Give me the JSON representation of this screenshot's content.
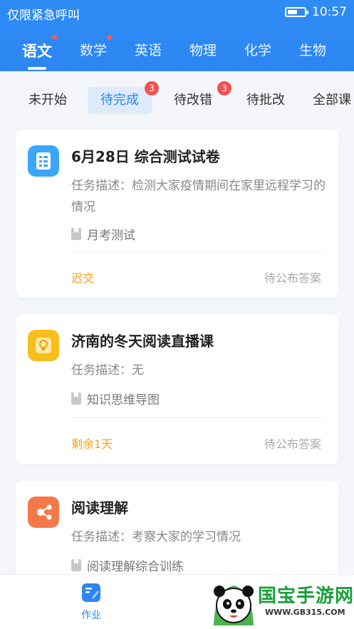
{
  "status_bar": {
    "carrier": "仅限紧急呼叫",
    "time": "10:57",
    "battery_level": 0.6
  },
  "subjects": [
    {
      "label": "语文",
      "active": true,
      "dot": true
    },
    {
      "label": "数学",
      "active": false,
      "dot": true
    },
    {
      "label": "英语",
      "active": false,
      "dot": false
    },
    {
      "label": "物理",
      "active": false,
      "dot": false
    },
    {
      "label": "化学",
      "active": false,
      "dot": false
    },
    {
      "label": "生物",
      "active": false,
      "dot": false
    }
  ],
  "status_tabs": [
    {
      "label": "未开始",
      "active": false,
      "badge": ""
    },
    {
      "label": "待完成",
      "active": true,
      "badge": "3"
    },
    {
      "label": "待改错",
      "active": false,
      "badge": "3"
    },
    {
      "label": "待批改",
      "active": false,
      "badge": ""
    },
    {
      "label": "全部课",
      "active": false,
      "badge": ""
    }
  ],
  "cards": [
    {
      "title": "6月28日  综合测试试卷",
      "description": "任务描述：检测大家疫情期间在家里远程学习的情况",
      "tag": "月考测试",
      "status": "迟交",
      "answer_status": "待公布答案",
      "icon": "test-paper-icon",
      "icon_color": "#3aa6f7"
    },
    {
      "title": "济南的冬天阅读直播课",
      "description": "任务描述：无",
      "tag": "知识思维导图",
      "status": "剩余1天",
      "answer_status": "待公布答案",
      "icon": "lightbulb-icon",
      "icon_color": "#f7be1c"
    },
    {
      "title": "阅读理解",
      "description": "任务描述：考察大家的学习情况",
      "tag": "阅读理解综合训练",
      "status": "",
      "answer_status": "",
      "icon": "mind-map-icon",
      "icon_color": "#f4794a"
    }
  ],
  "bottom_nav": {
    "homework_label": "作业"
  },
  "watermark": {
    "brand": "国宝手游网",
    "url": "WWW.GB315.COM"
  },
  "colors": {
    "primary": "#2c86f2",
    "late": "#f5a020",
    "badge": "#f05252"
  }
}
